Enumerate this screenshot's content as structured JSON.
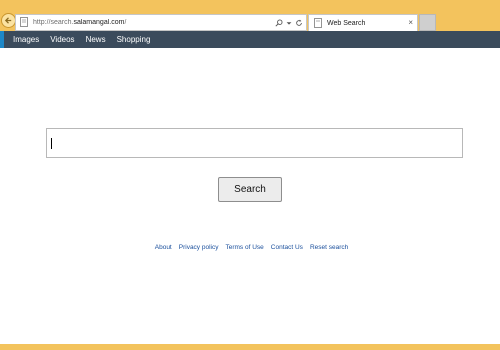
{
  "browser": {
    "url_prefix": "http://search.",
    "url_domain": "salamangal.com",
    "url_suffix": "/",
    "tab_title": "Web Search",
    "tab_close": "×"
  },
  "nav": {
    "items": [
      "Images",
      "Videos",
      "News",
      "Shopping"
    ]
  },
  "search": {
    "input_value": "",
    "button_label": "Search"
  },
  "footer": {
    "links": [
      "About",
      "Privacy policy",
      "Terms of Use",
      "Contact Us",
      "Reset search"
    ]
  },
  "colors": {
    "chrome": "#f3c35d",
    "nav_background": "#3b4b5c",
    "nav_accent": "#1e88c8",
    "link": "#1a4f9c"
  }
}
